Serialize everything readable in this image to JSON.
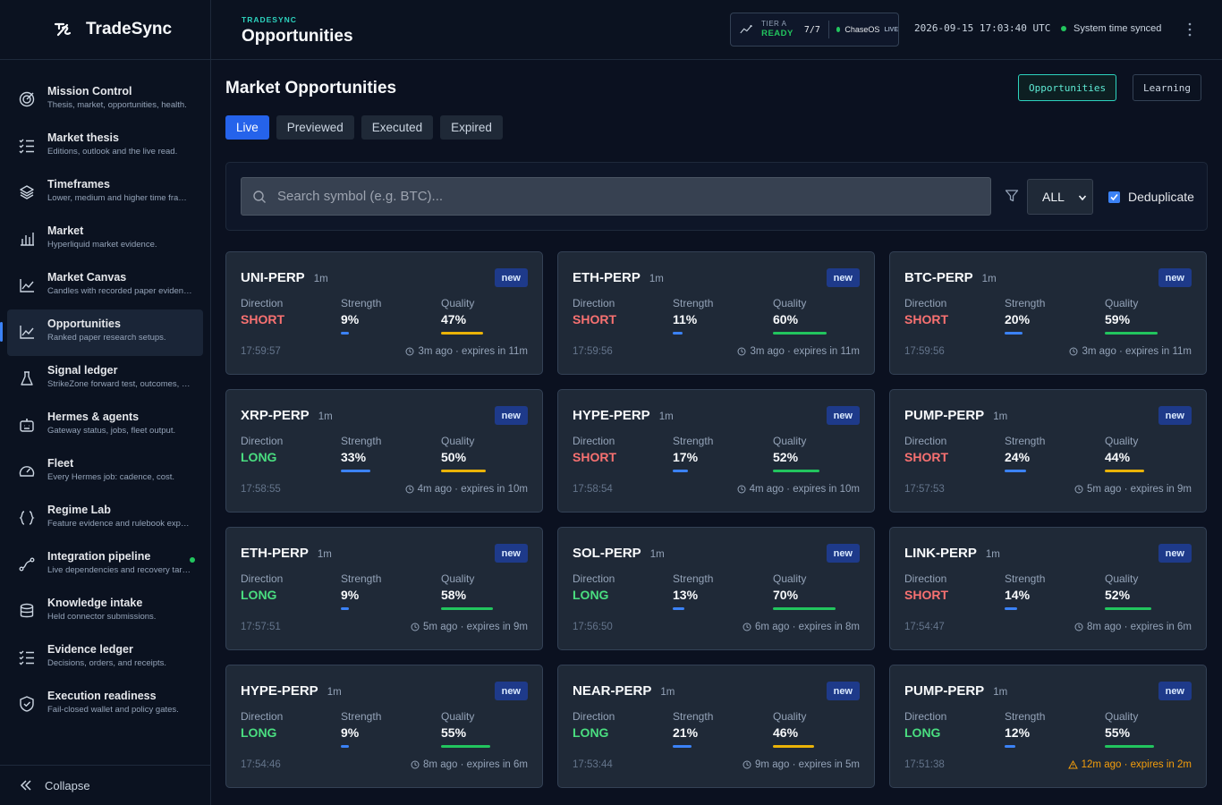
{
  "brand": {
    "name": "TradeSync",
    "icon": "tradesync-logo-icon"
  },
  "sidebar": {
    "items": [
      {
        "title": "Mission Control",
        "sub": "Thesis, market, opportunities, health.",
        "icon": "target-icon"
      },
      {
        "title": "Market thesis",
        "sub": "Editions, outlook and the live read.",
        "icon": "list-check-icon"
      },
      {
        "title": "Timeframes",
        "sub": "Lower, medium and higher time frames.",
        "icon": "layers-icon"
      },
      {
        "title": "Market",
        "sub": "Hyperliquid market evidence.",
        "icon": "bar-chart-icon"
      },
      {
        "title": "Market Canvas",
        "sub": "Candles with recorded paper evidence.",
        "icon": "trend-line-icon"
      },
      {
        "title": "Opportunities",
        "sub": "Ranked paper research setups.",
        "icon": "trend-line-icon",
        "active": true
      },
      {
        "title": "Signal ledger",
        "sub": "StrikeZone forward test, outcomes, and more.",
        "icon": "flask-icon"
      },
      {
        "title": "Hermes & agents",
        "sub": "Gateway status, jobs, fleet output.",
        "icon": "robot-icon"
      },
      {
        "title": "Fleet",
        "sub": "Every Hermes job: cadence, cost.",
        "icon": "gauge-icon"
      },
      {
        "title": "Regime Lab",
        "sub": "Feature evidence and rulebook experiments.",
        "icon": "braces-icon"
      },
      {
        "title": "Integration pipeline",
        "sub": "Live dependencies and recovery targets.",
        "icon": "pipeline-icon",
        "dot": true
      },
      {
        "title": "Knowledge intake",
        "sub": "Held connector submissions.",
        "icon": "database-icon"
      },
      {
        "title": "Evidence ledger",
        "sub": "Decisions, orders, and receipts.",
        "icon": "list-check-icon"
      },
      {
        "title": "Execution readiness",
        "sub": "Fail-closed wallet and policy gates.",
        "icon": "shield-check-icon"
      }
    ],
    "collapse_label": "Collapse"
  },
  "header": {
    "eyebrow": "TRADESYNC",
    "title": "Opportunities",
    "tier_label": "TIER A",
    "tier_status": "READY",
    "tier_count": "7/7",
    "os_name": "ChaseOS",
    "os_status": "LIVE",
    "clock": "2026-09-15 17:03:40 UTC",
    "sync_status": "System time synced"
  },
  "main": {
    "title": "Market Opportunities",
    "view_toggle": {
      "active": "Opportunities",
      "inactive": "Learning"
    },
    "tabs": [
      "Live",
      "Previewed",
      "Executed",
      "Expired"
    ],
    "search": {
      "placeholder": "Search symbol (e.g. BTC)...",
      "value": ""
    },
    "filter_select": "ALL",
    "dedup_label": "Deduplicate",
    "labels": {
      "direction": "Direction",
      "strength": "Strength",
      "quality": "Quality",
      "badge": "new"
    }
  },
  "colors": {
    "accent": "#2563eb",
    "teal": "#2dd4bf",
    "short": "#f87171",
    "long": "#4ade80",
    "bar_blue": "#3b82f6",
    "bar_yellow": "#eab308",
    "bar_green": "#22c55e",
    "warn": "#f59e0b"
  },
  "cards": [
    {
      "symbol": "UNI-PERP",
      "tf": "1m",
      "direction": "SHORT",
      "strength": "9%",
      "quality": "47%",
      "strength_frac": 0.09,
      "quality_frac": 0.47,
      "quality_color": "yellow",
      "time": "17:59:57",
      "ago": "3m ago · expires in 11m",
      "warn": false
    },
    {
      "symbol": "ETH-PERP",
      "tf": "1m",
      "direction": "SHORT",
      "strength": "11%",
      "quality": "60%",
      "strength_frac": 0.11,
      "quality_frac": 0.6,
      "quality_color": "green",
      "time": "17:59:56",
      "ago": "3m ago · expires in 11m",
      "warn": false
    },
    {
      "symbol": "BTC-PERP",
      "tf": "1m",
      "direction": "SHORT",
      "strength": "20%",
      "quality": "59%",
      "strength_frac": 0.2,
      "quality_frac": 0.59,
      "quality_color": "green",
      "time": "17:59:56",
      "ago": "3m ago · expires in 11m",
      "warn": false
    },
    {
      "symbol": "XRP-PERP",
      "tf": "1m",
      "direction": "LONG",
      "strength": "33%",
      "quality": "50%",
      "strength_frac": 0.33,
      "quality_frac": 0.5,
      "quality_color": "yellow",
      "time": "17:58:55",
      "ago": "4m ago · expires in 10m",
      "warn": false
    },
    {
      "symbol": "HYPE-PERP",
      "tf": "1m",
      "direction": "SHORT",
      "strength": "17%",
      "quality": "52%",
      "strength_frac": 0.17,
      "quality_frac": 0.52,
      "quality_color": "green",
      "time": "17:58:54",
      "ago": "4m ago · expires in 10m",
      "warn": false
    },
    {
      "symbol": "PUMP-PERP",
      "tf": "1m",
      "direction": "SHORT",
      "strength": "24%",
      "quality": "44%",
      "strength_frac": 0.24,
      "quality_frac": 0.44,
      "quality_color": "yellow",
      "time": "17:57:53",
      "ago": "5m ago · expires in 9m",
      "warn": false
    },
    {
      "symbol": "ETH-PERP",
      "tf": "1m",
      "direction": "LONG",
      "strength": "9%",
      "quality": "58%",
      "strength_frac": 0.09,
      "quality_frac": 0.58,
      "quality_color": "green",
      "time": "17:57:51",
      "ago": "5m ago · expires in 9m",
      "warn": false
    },
    {
      "symbol": "SOL-PERP",
      "tf": "1m",
      "direction": "LONG",
      "strength": "13%",
      "quality": "70%",
      "strength_frac": 0.13,
      "quality_frac": 0.7,
      "quality_color": "green",
      "time": "17:56:50",
      "ago": "6m ago · expires in 8m",
      "warn": false
    },
    {
      "symbol": "LINK-PERP",
      "tf": "1m",
      "direction": "SHORT",
      "strength": "14%",
      "quality": "52%",
      "strength_frac": 0.14,
      "quality_frac": 0.52,
      "quality_color": "green",
      "time": "17:54:47",
      "ago": "8m ago · expires in 6m",
      "warn": false
    },
    {
      "symbol": "HYPE-PERP",
      "tf": "1m",
      "direction": "LONG",
      "strength": "9%",
      "quality": "55%",
      "strength_frac": 0.09,
      "quality_frac": 0.55,
      "quality_color": "green",
      "time": "17:54:46",
      "ago": "8m ago · expires in 6m",
      "warn": false
    },
    {
      "symbol": "NEAR-PERP",
      "tf": "1m",
      "direction": "LONG",
      "strength": "21%",
      "quality": "46%",
      "strength_frac": 0.21,
      "quality_frac": 0.46,
      "quality_color": "yellow",
      "time": "17:53:44",
      "ago": "9m ago · expires in 5m",
      "warn": false
    },
    {
      "symbol": "PUMP-PERP",
      "tf": "1m",
      "direction": "LONG",
      "strength": "12%",
      "quality": "55%",
      "strength_frac": 0.12,
      "quality_frac": 0.55,
      "quality_color": "green",
      "time": "17:51:38",
      "ago": "12m ago · expires in 2m",
      "warn": true
    }
  ]
}
